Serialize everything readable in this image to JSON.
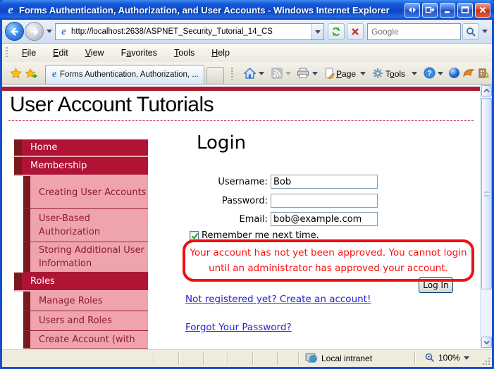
{
  "window": {
    "title": "Forms Authentication, Authorization, and User Accounts - Windows Internet Explorer"
  },
  "nav": {
    "url": "http://localhost:2638/ASPNET_Security_Tutorial_14_CS",
    "search_placeholder": "Google"
  },
  "menus": {
    "items": [
      {
        "pre": "",
        "key": "F",
        "rest": "ile"
      },
      {
        "pre": "",
        "key": "E",
        "rest": "dit"
      },
      {
        "pre": "",
        "key": "V",
        "rest": "iew"
      },
      {
        "pre": "F",
        "key": "a",
        "rest": "vorites"
      },
      {
        "pre": "",
        "key": "T",
        "rest": "ools"
      },
      {
        "pre": "",
        "key": "H",
        "rest": "elp"
      }
    ]
  },
  "command_bar": {
    "tab_title": "Forms Authentication, Authorization, ...",
    "page_button": {
      "pre": "",
      "key": "P",
      "rest": "age"
    },
    "tools_button": {
      "pre": "T",
      "key": "o",
      "rest": "ols"
    }
  },
  "content": {
    "site_title": "User Account Tutorials",
    "sidebar": {
      "items": [
        {
          "label": "Home"
        },
        {
          "label": "Membership"
        },
        {
          "label": "Creating User Accounts"
        },
        {
          "label": "User-Based Authorization"
        },
        {
          "label": "Storing Additional User Information"
        },
        {
          "label": "Roles"
        },
        {
          "label": "Manage Roles"
        },
        {
          "label": "Users and Roles"
        },
        {
          "label": "Create Account (with"
        }
      ]
    },
    "login": {
      "heading": "Login",
      "username_label": "Username:",
      "username_value": "Bob",
      "password_label": "Password:",
      "password_value": "",
      "email_label": "Email:",
      "email_value": "bob@example.com",
      "remember_label": "Remember me next time.",
      "error_message": "Your account has not yet been approved. You cannot login until an administrator has approved your account.",
      "login_button": "Log In",
      "register_link": "Not registered yet? Create an account!",
      "forgot_link": "Forgot Your Password?"
    }
  },
  "status_bar": {
    "zone": "Local intranet",
    "zoom": "100%"
  },
  "colors": {
    "titlebar_blue": "#0C46C6",
    "frame_blue": "#1450CE",
    "nav_crimson": "#B01334",
    "nav_dark_strip": "#7A191D",
    "nav_pink": "#EFA4AD",
    "nav_maroon_text": "#8C1B28",
    "header_bar_red": "#A81D33",
    "error_red": "#FB0D0D",
    "link_blue": "#2424CC"
  }
}
